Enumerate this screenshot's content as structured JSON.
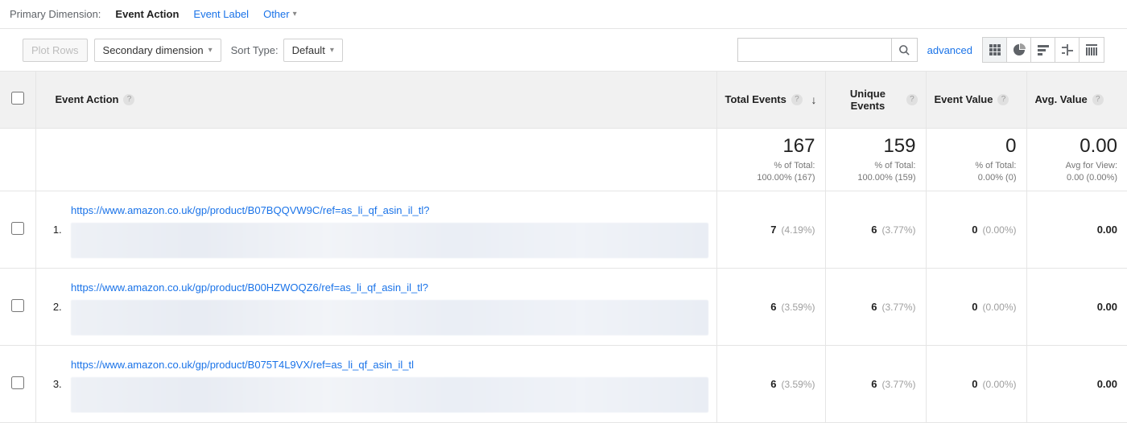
{
  "primaryDimension": {
    "label": "Primary Dimension:",
    "tabs": [
      "Event Action",
      "Event Label"
    ],
    "active": "Event Action",
    "other": "Other"
  },
  "toolbar": {
    "plotRows": "Plot Rows",
    "secondaryDim": "Secondary dimension",
    "sortTypeLabel": "Sort Type:",
    "sortDefault": "Default",
    "advanced": "advanced"
  },
  "columns": {
    "eventAction": "Event Action",
    "totalEvents": "Total Events",
    "uniqueEvents": "Unique Events",
    "eventValue": "Event Value",
    "avgValue": "Avg. Value"
  },
  "totals": {
    "totalEvents": {
      "value": "167",
      "sub1": "% of Total:",
      "sub2": "100.00% (167)"
    },
    "uniqueEvents": {
      "value": "159",
      "sub1": "% of Total:",
      "sub2": "100.00% (159)"
    },
    "eventValue": {
      "value": "0",
      "sub1": "% of Total:",
      "sub2": "0.00% (0)"
    },
    "avgValue": {
      "value": "0.00",
      "sub1": "Avg for View:",
      "sub2": "0.00 (0.00%)"
    }
  },
  "rows": [
    {
      "n": "1.",
      "url": "https://www.amazon.co.uk/gp/product/B07BQQVW9C/ref=as_li_qf_asin_il_tl?",
      "totalEvents": "7",
      "totalEventsPct": "(4.19%)",
      "uniqueEvents": "6",
      "uniqueEventsPct": "(3.77%)",
      "eventValue": "0",
      "eventValuePct": "(0.00%)",
      "avgValue": "0.00"
    },
    {
      "n": "2.",
      "url": "https://www.amazon.co.uk/gp/product/B00HZWOQZ6/ref=as_li_qf_asin_il_tl?",
      "totalEvents": "6",
      "totalEventsPct": "(3.59%)",
      "uniqueEvents": "6",
      "uniqueEventsPct": "(3.77%)",
      "eventValue": "0",
      "eventValuePct": "(0.00%)",
      "avgValue": "0.00"
    },
    {
      "n": "3.",
      "url": "https://www.amazon.co.uk/gp/product/B075T4L9VX/ref=as_li_qf_asin_il_tl",
      "totalEvents": "6",
      "totalEventsPct": "(3.59%)",
      "uniqueEvents": "6",
      "uniqueEventsPct": "(3.77%)",
      "eventValue": "0",
      "eventValuePct": "(0.00%)",
      "avgValue": "0.00"
    }
  ]
}
